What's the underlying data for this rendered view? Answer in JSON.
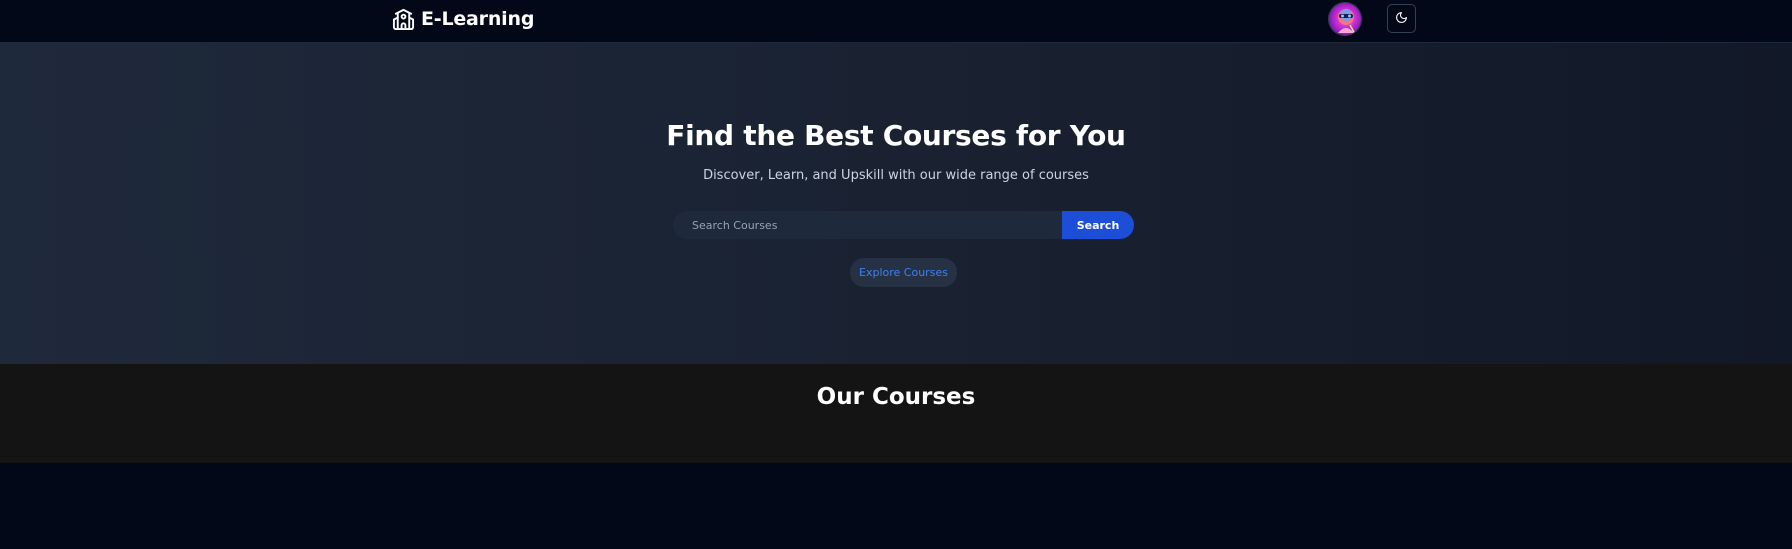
{
  "header": {
    "brand": {
      "name": "E-Learning",
      "icon": "school-icon"
    },
    "avatar": {
      "icon": "user-avatar"
    },
    "theme_toggle": {
      "icon": "moon-icon"
    }
  },
  "hero": {
    "title": "Find the Best Courses for You",
    "subtitle": "Discover, Learn, and Upskill with our wide range of courses",
    "search": {
      "placeholder": "Search Courses",
      "value": "",
      "button_label": "Search"
    },
    "explore_label": "Explore Courses"
  },
  "courses": {
    "title": "Our Courses"
  },
  "colors": {
    "accent": "#1d4ed8",
    "link": "#3b82f6",
    "background": "#020817"
  }
}
